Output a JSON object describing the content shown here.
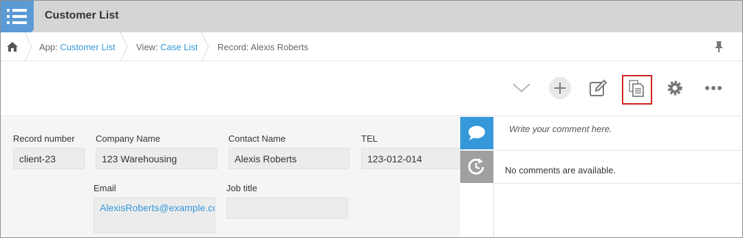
{
  "app": {
    "title": "Customer List"
  },
  "breadcrumb": {
    "app_prefix": "App: ",
    "app_link": "Customer List",
    "view_prefix": "View: ",
    "view_link": "Case List",
    "record": "Record: Alexis Roberts"
  },
  "toolbar": {
    "icons": [
      "chevron-down-icon",
      "add-icon",
      "edit-icon",
      "duplicate-icon",
      "gear-icon",
      "more-icon"
    ],
    "highlighted": "duplicate-icon",
    "highlight_color": "#d0201d"
  },
  "record": {
    "fields": {
      "record_number": {
        "label": "Record number",
        "value": "client-23"
      },
      "company_name": {
        "label": "Company Name",
        "value": "123 Warehousing"
      },
      "contact_name": {
        "label": "Contact Name",
        "value": "Alexis Roberts"
      },
      "tel": {
        "label": "TEL",
        "value": "123-012-014"
      },
      "email": {
        "label": "Email",
        "value": "AlexisRoberts@example.com"
      },
      "job_title": {
        "label": "Job title",
        "value": ""
      }
    }
  },
  "comments": {
    "placeholder": "Write your comment here.",
    "empty_message": "No comments are available."
  },
  "colors": {
    "accent": "#3498db",
    "title_bar": "#d4d6d6",
    "app_icon": "#5b9ad5",
    "record_bg": "#f5f5f5"
  }
}
